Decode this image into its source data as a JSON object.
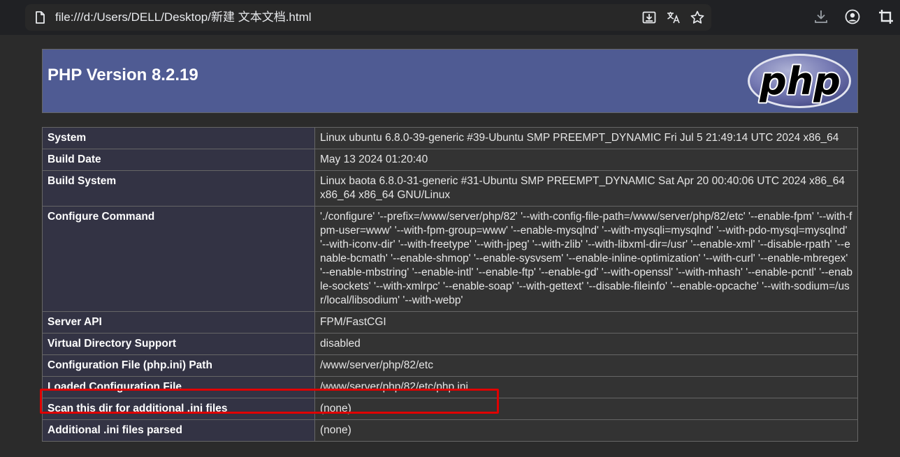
{
  "browser": {
    "url": "file:///d:/Users/DELL/Desktop/新建 文本文档.html",
    "icons": [
      "page-icon",
      "install-app-icon",
      "translate-icon",
      "bookmark-star-icon",
      "download-icon",
      "profile-icon",
      "extensions-icon"
    ]
  },
  "phpinfo": {
    "title": "PHP Version 8.2.19",
    "logo_text": "php",
    "rows": [
      {
        "key": "System",
        "value": "Linux ubuntu 6.8.0-39-generic #39-Ubuntu SMP PREEMPT_DYNAMIC Fri Jul 5 21:49:14 UTC 2024 x86_64"
      },
      {
        "key": "Build Date",
        "value": "May 13 2024 01:20:40"
      },
      {
        "key": "Build System",
        "value": "Linux baota 6.8.0-31-generic #31-Ubuntu SMP PREEMPT_DYNAMIC Sat Apr 20 00:40:06 UTC 2024 x86_64 x86_64 x86_64 GNU/Linux"
      },
      {
        "key": "Configure Command",
        "value": "'./configure' '--prefix=/www/server/php/82' '--with-config-file-path=/www/server/php/82/etc' '--enable-fpm' '--with-fpm-user=www' '--with-fpm-group=www' '--enable-mysqlnd' '--with-mysqli=mysqlnd' '--with-pdo-mysql=mysqlnd' '--with-iconv-dir' '--with-freetype' '--with-jpeg' '--with-zlib' '--with-libxml-dir=/usr' '--enable-xml' '--disable-rpath' '--enable-bcmath' '--enable-shmop' '--enable-sysvsem' '--enable-inline-optimization' '--with-curl' '--enable-mbregex' '--enable-mbstring' '--enable-intl' '--enable-ftp' '--enable-gd' '--with-openssl' '--with-mhash' '--enable-pcntl' '--enable-sockets' '--with-xmlrpc' '--enable-soap' '--with-gettext' '--disable-fileinfo' '--enable-opcache' '--with-sodium=/usr/local/libsodium' '--with-webp'"
      },
      {
        "key": "Server API",
        "value": "FPM/FastCGI"
      },
      {
        "key": "Virtual Directory Support",
        "value": "disabled"
      },
      {
        "key": "Configuration File (php.ini) Path",
        "value": "/www/server/php/82/etc"
      },
      {
        "key": "Loaded Configuration File",
        "value": "/www/server/php/82/etc/php.ini"
      },
      {
        "key": "Scan this dir for additional .ini files",
        "value": "(none)"
      },
      {
        "key": "Additional .ini files parsed",
        "value": "(none)"
      }
    ]
  },
  "colors": {
    "header_bg": "#4f5b93",
    "key_cell_bg": "#334",
    "value_cell_bg": "#333",
    "highlight_border": "#e00000"
  }
}
